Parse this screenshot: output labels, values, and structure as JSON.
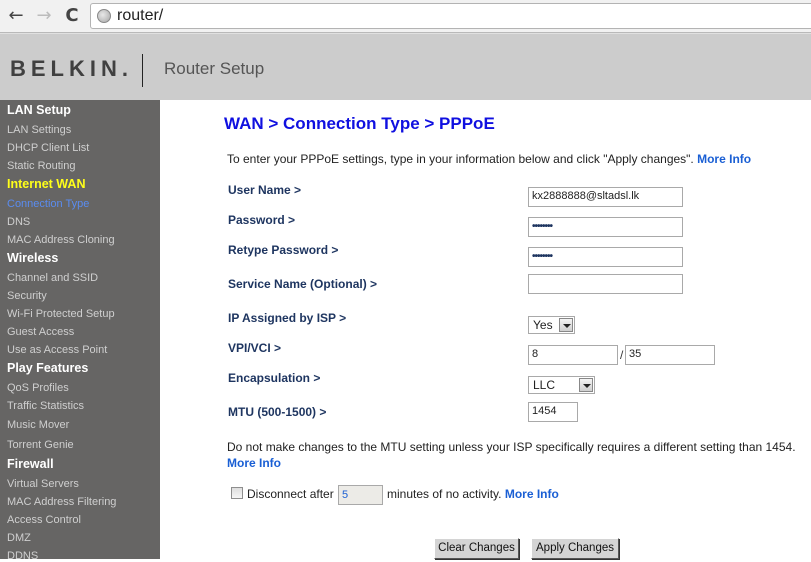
{
  "browser": {
    "url": "router/",
    "back_icon": "←",
    "forward_icon": "→",
    "reload_icon": "C"
  },
  "header": {
    "logo": "BELKIN.",
    "title": "Router Setup"
  },
  "sidebar": {
    "sections": [
      {
        "label": "LAN Setup",
        "active": false,
        "items": [
          "LAN Settings",
          "DHCP Client List",
          "Static Routing"
        ]
      },
      {
        "label": "Internet WAN",
        "active": true,
        "items": [
          "Connection Type",
          "DNS",
          "MAC Address Cloning"
        ],
        "current": "Connection Type"
      },
      {
        "label": "Wireless",
        "active": false,
        "items": [
          "Channel and SSID",
          "Security",
          "Wi-Fi Protected Setup",
          "Guest Access",
          "Use as Access Point"
        ]
      },
      {
        "label": "Play Features",
        "active": false,
        "items": [
          "QoS Profiles",
          "Traffic Statistics",
          "Music Mover",
          "Torrent Genie"
        ]
      },
      {
        "label": "Firewall",
        "active": false,
        "items": [
          "Virtual Servers",
          "MAC Address Filtering",
          "Access Control",
          "DMZ",
          "DDNS"
        ]
      }
    ]
  },
  "main": {
    "title": "WAN > Connection Type > PPPoE",
    "intro": "To enter your PPPoE settings, type in your information below and click \"Apply changes\".",
    "more_info": "More Info",
    "fields": {
      "username": {
        "label": "User Name >",
        "value": "kx2888888@sltadsl.lk"
      },
      "password": {
        "label": "Password >",
        "value": "••••••••"
      },
      "retype_password": {
        "label": "Retype Password >",
        "value": "••••••••"
      },
      "service_name": {
        "label": "Service Name (Optional) >",
        "value": ""
      },
      "ip_assigned": {
        "label": "IP Assigned by ISP >",
        "value": "Yes"
      },
      "vpi_vci": {
        "label": "VPI/VCI >",
        "vpi": "8",
        "separator": "/",
        "vci": "35"
      },
      "encapsulation": {
        "label": "Encapsulation >",
        "value": "LLC"
      },
      "mtu": {
        "label": "MTU (500-1500) >",
        "value": "1454"
      }
    },
    "mtu_note": "Do not make changes to the MTU setting unless your ISP specifically requires a different setting than 1454.",
    "disconnect": {
      "checked": false,
      "prefix": "Disconnect after",
      "minutes": "5",
      "suffix": "minutes of no activity."
    },
    "buttons": {
      "clear": "Clear Changes",
      "apply": "Apply Changes"
    }
  }
}
